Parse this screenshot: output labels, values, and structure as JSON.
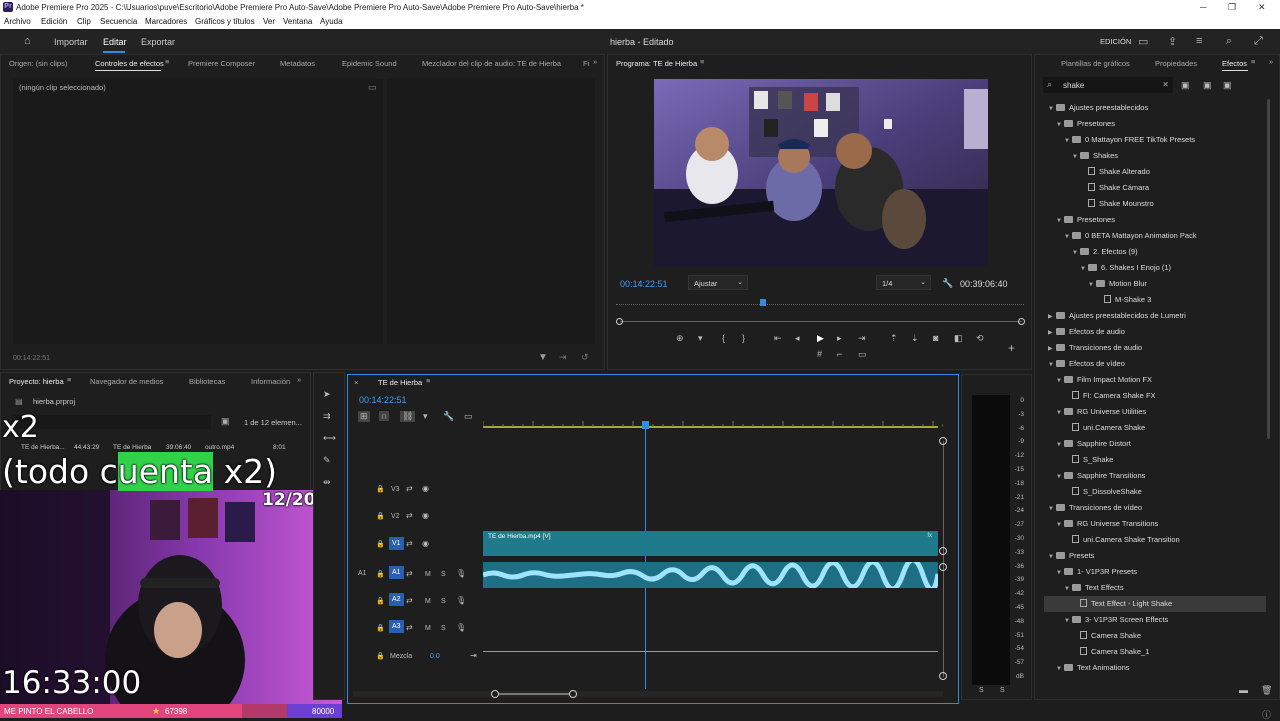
{
  "window": {
    "title": "Adobe Premiere Pro 2025 - C:\\Usuarios\\puve\\Escritorio\\Adobe Premiere Pro Auto-Save\\Adobe Premiere Pro Auto-Save\\Adobe Premiere Pro Auto-Save\\hierba *",
    "app_badge": "Pr"
  },
  "menu": [
    "Archivo",
    "Edición",
    "Clip",
    "Secuencia",
    "Marcadores",
    "Gráficos y títulos",
    "Ver",
    "Ventana",
    "Ayuda"
  ],
  "header": {
    "nav": [
      "Importar",
      "Editar",
      "Exportar"
    ],
    "project_title": "hierba - Editado",
    "workspace": "EDICIÓN"
  },
  "source_panel": {
    "tabs": [
      "Origen: (sin clips)",
      "Controles de efectos",
      "Premiere Composer",
      "Metadatos",
      "Epidemic Sound",
      "Mezclador del clip de audio: TE de Hierba",
      "Fi"
    ],
    "no_clip": "(ningún clip seleccionado)",
    "timecode": "00:14:22:51"
  },
  "program": {
    "tab": "Programa: TE de Hierba",
    "timecode": "00:14:22:51",
    "fit": "Ajustar",
    "resolution": "1/4",
    "duration": "00:39:06:40",
    "playhead": 0.36
  },
  "right_panel": {
    "tabs": [
      "Plantillas de gráficos",
      "Propiedades",
      "Efectos"
    ],
    "search": "shake",
    "tree": [
      {
        "d": 0,
        "t": "f",
        "label": "Ajustes preestablecidos"
      },
      {
        "d": 1,
        "t": "f",
        "label": "Presetones"
      },
      {
        "d": 2,
        "t": "f",
        "label": "0 Mattayon FREE TikTok Presets"
      },
      {
        "d": 3,
        "t": "f",
        "label": "Shakes"
      },
      {
        "d": 4,
        "t": "x",
        "label": "Shake Alterado"
      },
      {
        "d": 4,
        "t": "x",
        "label": "Shake Cámara"
      },
      {
        "d": 4,
        "t": "x",
        "label": "Shake Mounstro"
      },
      {
        "d": 1,
        "t": "f",
        "label": "Presetones"
      },
      {
        "d": 2,
        "t": "f",
        "label": "0 BETA Mattayon Animation Pack"
      },
      {
        "d": 3,
        "t": "f",
        "label": "2. Efectos (9)"
      },
      {
        "d": 4,
        "t": "f",
        "label": "6. Shakes I Enojo (1)"
      },
      {
        "d": 5,
        "t": "f",
        "label": "Motion Blur"
      },
      {
        "d": 6,
        "t": "x",
        "label": "M-Shake 3"
      },
      {
        "d": 0,
        "t": "f",
        "label": "Ajustes preestablecidos de Lumetri",
        "c": 1
      },
      {
        "d": 0,
        "t": "f",
        "label": "Efectos de audio",
        "c": 1
      },
      {
        "d": 0,
        "t": "f",
        "label": "Transiciones de audio",
        "c": 1
      },
      {
        "d": 0,
        "t": "f",
        "label": "Efectos de vídeo"
      },
      {
        "d": 1,
        "t": "f",
        "label": "Film Impact Motion FX"
      },
      {
        "d": 2,
        "t": "x",
        "label": "FI: Camera Shake FX"
      },
      {
        "d": 1,
        "t": "f",
        "label": "RG Universe Utilities"
      },
      {
        "d": 2,
        "t": "x",
        "label": "uni.Camera Shake"
      },
      {
        "d": 1,
        "t": "f",
        "label": "Sapphire Distort"
      },
      {
        "d": 2,
        "t": "x",
        "label": "S_Shake"
      },
      {
        "d": 1,
        "t": "f",
        "label": "Sapphire Transitions"
      },
      {
        "d": 2,
        "t": "x",
        "label": "S_DissolveShake"
      },
      {
        "d": 0,
        "t": "f",
        "label": "Transiciones de vídeo"
      },
      {
        "d": 1,
        "t": "f",
        "label": "RG Universe Transitions"
      },
      {
        "d": 2,
        "t": "x",
        "label": "uni.Camera Shake Transition"
      },
      {
        "d": 0,
        "t": "f",
        "label": "Presets"
      },
      {
        "d": 1,
        "t": "f",
        "label": "1- V1P3R Presets"
      },
      {
        "d": 2,
        "t": "f",
        "label": "Text Effects"
      },
      {
        "d": 3,
        "t": "x",
        "label": "Text Effect - Light Shake",
        "sel": 1
      },
      {
        "d": 2,
        "t": "f",
        "label": "3- V1P3R Screen Effects"
      },
      {
        "d": 3,
        "t": "x",
        "label": "Camera Shake"
      },
      {
        "d": 3,
        "t": "x",
        "label": "Camera Shake_1"
      },
      {
        "d": 1,
        "t": "f",
        "label": "Text Animations"
      }
    ]
  },
  "project_panel": {
    "tabs": [
      "Proyecto: hierba",
      "Navegador de medios",
      "Bibliotecas",
      "Información"
    ],
    "file": "hierba.prproj",
    "count": "1 de 12 elemen...",
    "thumbs": [
      {
        "name": "TE de Hierba...",
        "dur": "44:43:29"
      },
      {
        "name": "TE de Hierba",
        "dur": "39:06:40"
      },
      {
        "name": "outro.mp4",
        "dur": "8:01"
      }
    ]
  },
  "timeline": {
    "tab": "TE de Hierba",
    "timecode": "00:14:22:51",
    "tracks": [
      "V3",
      "V2",
      "V1",
      "A1",
      "A2",
      "A3"
    ],
    "a1_source": "A1",
    "mix_label": "Mezcla",
    "mix_value": "0.0",
    "clip": "TE de Hierba.mp4 [V]",
    "playhead": 0.356,
    "meter_scale": [
      "0",
      "-3",
      "-6",
      "-9",
      "-12",
      "-15",
      "-18",
      "-21",
      "-24",
      "-27",
      "-30",
      "-33",
      "-36",
      "-39",
      "-42",
      "-45",
      "-48",
      "-51",
      "-54",
      "-57",
      "dB"
    ],
    "meter_btns": [
      "S",
      "S"
    ]
  },
  "stream_overlay": {
    "x2": "x2",
    "line": "(todo cuenta x2)",
    "line_a": "(todo c",
    "line_b": "uenta",
    "line_c": " x2)",
    "counter": "12/20",
    "clock": "16:33:00",
    "goal_text": "ME PINTO EL CABELLO",
    "goal_current": "67398",
    "goal_target": "80000"
  },
  "colors": {
    "accent": "#2d8ceb",
    "clip_video": "#1f7a8c",
    "clip_audio": "#1e6f86",
    "goal_pink": "#e0457b",
    "goal_purple": "#6a3fd1"
  }
}
